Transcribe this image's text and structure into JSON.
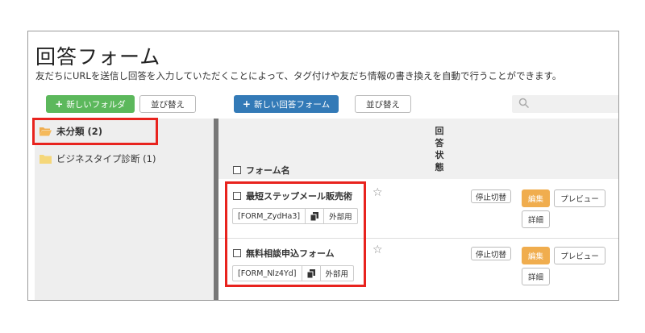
{
  "header": {
    "title": "回答フォーム",
    "description": "友だちにURLを送信し回答を入力していただくことによって、タグ付けや友だち情報の書き換えを自動で行うことができます。"
  },
  "toolbar": {
    "new_folder_label": "新しいフォルダ",
    "sort_folders_label": "並び替え",
    "new_form_label": "新しい回答フォーム",
    "sort_forms_label": "並び替え",
    "search_value": ""
  },
  "sidebar": {
    "folders": [
      {
        "label": "未分類 (2)",
        "color": "#f0ad4e"
      },
      {
        "label": "ビジネスタイプ診断 (1)",
        "color": "#f5d77a"
      }
    ]
  },
  "table": {
    "headers": {
      "name": "フォーム名",
      "status": "回答状態"
    },
    "rows": [
      {
        "name": "最短ステップメール販売術",
        "form_id": "[FORM_ZydHa3]",
        "external_label": "外部用",
        "stop_label": "停止切替",
        "edit_label": "編集",
        "preview_label": "プレビュー",
        "detail_label": "詳細"
      },
      {
        "name": "無料相談申込フォーム",
        "form_id": "[FORM_Nlz4Yd]",
        "external_label": "外部用",
        "stop_label": "停止切替",
        "edit_label": "編集",
        "preview_label": "プレビュー",
        "detail_label": "詳細"
      }
    ]
  },
  "icons": {
    "plus": "plus-icon",
    "search": "search-icon",
    "folder": "folder-icon",
    "copy": "copy-icon",
    "star": "star-icon"
  },
  "colors": {
    "green": "#5cb85c",
    "blue": "#337ab7",
    "orange": "#f0ad4e",
    "highlight": "#e8231e"
  }
}
